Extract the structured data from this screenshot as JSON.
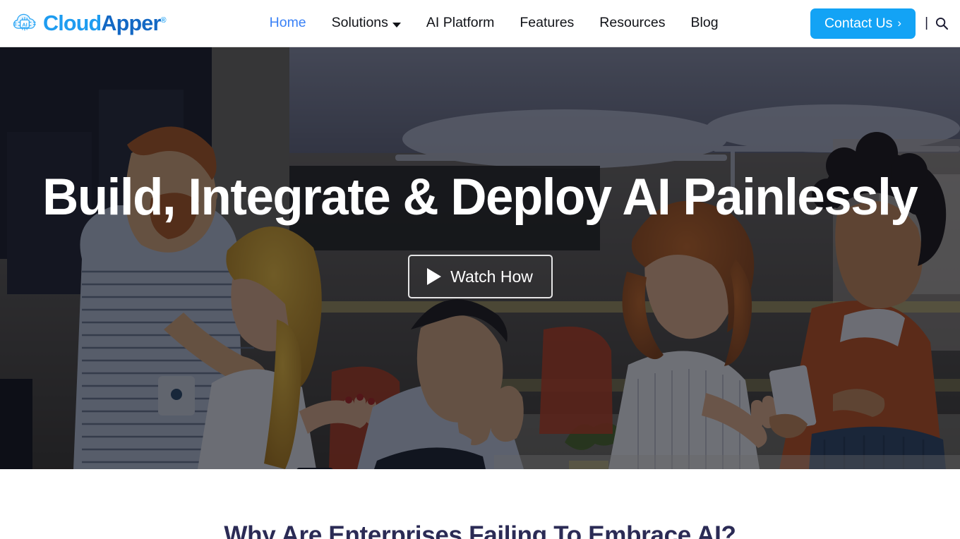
{
  "brand": {
    "name_part1": "Cloud",
    "name_part2": "Apper",
    "trademark": "®",
    "logo_icon": "cloud-ai-chip-logo"
  },
  "nav": {
    "items": [
      {
        "label": "Home",
        "active": true,
        "has_dropdown": false
      },
      {
        "label": "Solutions",
        "active": false,
        "has_dropdown": true
      },
      {
        "label": "AI Platform",
        "active": false,
        "has_dropdown": false
      },
      {
        "label": "Features",
        "active": false,
        "has_dropdown": false
      },
      {
        "label": "Resources",
        "active": false,
        "has_dropdown": false
      },
      {
        "label": "Blog",
        "active": false,
        "has_dropdown": false
      }
    ],
    "contact_label": "Contact Us",
    "contact_arrow": "›",
    "separator": "|",
    "search_icon": "search-icon",
    "accent_color": "#13a3f5",
    "active_link_color": "#3b82f6",
    "link_color": "#111318"
  },
  "hero": {
    "heading": "Build, Integrate & Deploy AI Painlessly",
    "watch_label": "Watch How",
    "play_icon": "play-triangle-icon",
    "background_alt": "team-celebrating-in-office",
    "overlay_color": "#0a0c18"
  },
  "section": {
    "title": "Why Are Enterprises Failing To Embrace AI?",
    "title_color": "#2b2b55"
  }
}
